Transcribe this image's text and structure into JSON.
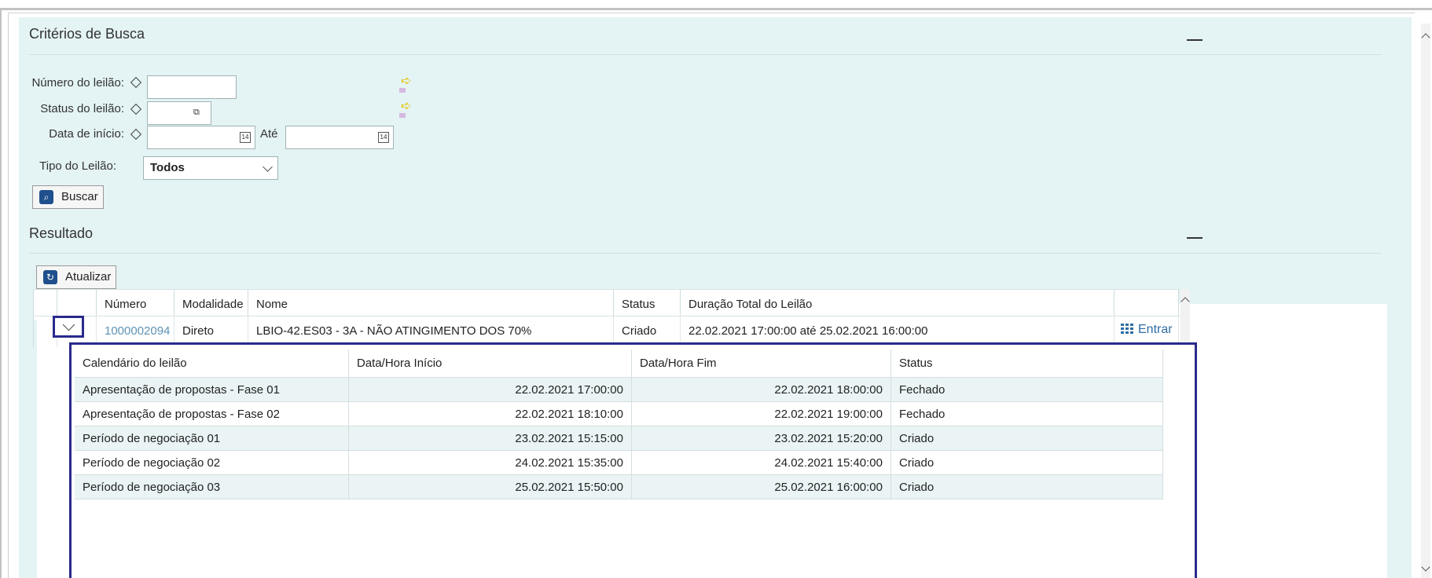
{
  "search_criteria": {
    "title": "Critérios de Busca",
    "fields": {
      "numero_label": "Número do leilão:",
      "numero_value": "",
      "status_label": "Status do leilão:",
      "status_value": "",
      "data_inicio_label": "Data de início:",
      "data_inicio_value": "",
      "ate_label": "Até",
      "ate_value": "",
      "tipo_label": "Tipo do Leilão:",
      "tipo_value": "Todos"
    },
    "buscar_label": "Buscar"
  },
  "results": {
    "title": "Resultado",
    "atualizar_label": "Atualizar",
    "columns": [
      "Número",
      "Modalidade",
      "Nome",
      "Status",
      "Duração Total do Leilão"
    ],
    "row": {
      "numero": "1000002094",
      "modalidade": "Direto",
      "nome": "LBIO-42.ES03 - 3A - NÃO ATINGIMENTO DOS 70%",
      "status": "Criado",
      "duracao": "22.02.2021 17:00:00 até 25.02.2021 16:00:00",
      "entrar_label": "Entrar"
    },
    "calendar": {
      "columns": [
        "Calendário do leilão",
        "Data/Hora Início",
        "Data/Hora Fim",
        "Status"
      ],
      "rows": [
        {
          "nome": "Apresentação de propostas - Fase 01",
          "inicio": "22.02.2021 17:00:00",
          "fim": "22.02.2021 18:00:00",
          "status": "Fechado"
        },
        {
          "nome": "Apresentação de propostas - Fase 02",
          "inicio": "22.02.2021 18:10:00",
          "fim": "22.02.2021 19:00:00",
          "status": "Fechado"
        },
        {
          "nome": "Período de negociação 01",
          "inicio": "23.02.2021 15:15:00",
          "fim": "23.02.2021 15:20:00",
          "status": "Criado"
        },
        {
          "nome": "Período de negociação 02",
          "inicio": "24.02.2021 15:35:00",
          "fim": "24.02.2021 15:40:00",
          "status": "Criado"
        },
        {
          "nome": "Período de negociação 03",
          "inicio": "25.02.2021 15:50:00",
          "fim": "25.02.2021 16:00:00",
          "status": "Criado"
        }
      ]
    }
  },
  "colors": {
    "panel_bg": "#e4f3f4",
    "highlight_border": "#2a2a8c",
    "link": "#5e93b4",
    "row_alt": "#eaf4f5"
  }
}
